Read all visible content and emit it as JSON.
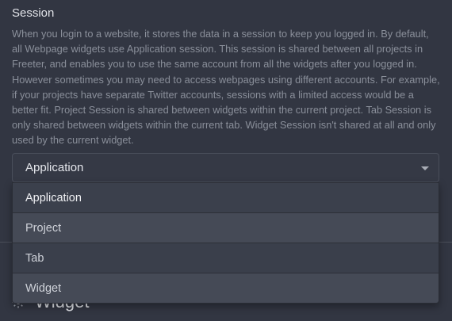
{
  "section": {
    "title": "Session",
    "description": "When you login to a website, it stores the data in a session to keep you logged in. By default, all Webpage widgets use Application session. This session is shared between all projects in Freeter, and enables you to use the same account from all the widgets after you logged in. However sometimes you may need to access webpages using different accounts. For example, if your projects have separate Twitter accounts, sessions with a limited access would be a better fit. Project Session is shared between widgets within the current project. Tab Session is only shared between widgets within the current tab. Widget Session isn't shared at all and only used by the current widget."
  },
  "select": {
    "selected_value": "Application",
    "options": [
      {
        "label": "Application"
      },
      {
        "label": "Project"
      },
      {
        "label": "Tab"
      },
      {
        "label": "Widget"
      }
    ]
  },
  "background": {
    "heading": "Widget",
    "icon": "gear-icon"
  }
}
